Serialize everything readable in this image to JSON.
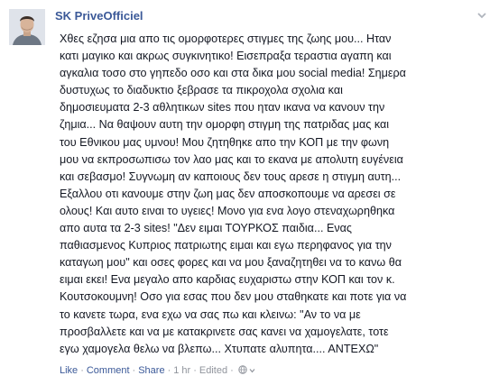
{
  "post": {
    "author": "SK PriveOfficiel",
    "text": "Χθες εζησα μια απο τις ομορφοτερες στιγμες της ζωης μου... Ηταν\nκατι μαγικο και ακρως συγκινητικο! Εισεπραξα τεραστια αγαπη και\nαγκαλια τοσο στο γηπεδο οσο και στα δικα μου social media! Σημερα\nδυστυχως το διαδυκτιο ξεβρασε τα πικροχολα σχολια και\nδημοσιευματα 2-3 αθλητικων sites που ηταν ικανα να κανουν την\nζημια... Να θαψουν αυτη την ομορφη στιγμη της πατριδας μας και\nτου Εθνικου μας υμνου! Μου ζητηθηκε απο την ΚΟΠ με την φωνη\nμου να εκπροσωπισω τον λαο μας και το εκανα με απολυτη ευγένεια\nκαι σεβασμο! Συγνωμη αν καποιους δεν τους αρεσε η στιγμη αυτη...\nΕξαλλου οτι κανουμε στην ζωη μας δεν αποσκοπουμε να αρεσει σε\nολους! Και αυτο ειναι το υγειες! Μονο για ενα λογο στεναχωρηθηκα\nαπο αυτα τα 2-3 sites! \"Δεν ειμαι ΤΟΥΡΚΟΣ παιδια... Ενας\nπαθιασμενος Κυπριος πατριωτης ειμαι και εγω περηφανος για την\nκαταγωη μου\" και οσες φορες και να μου ξαναζητηθει να το κανω θα\nειμαι εκει! Ενα μεγαλο απο καρδιας ευχαριστω στην ΚΟΠ και τον κ.\nΚουτσοκουμνη! Οσο για εσας που δεν μου σταθηκατε και ποτε για να\nτο κανετε τωρα, ενα εχω να σας πω και κλεινω: \"Αν το να με\nπροσβαλλετε και να με κατακρινετε σας κανει να χαμογελατε, τοτε\nεγω χαμογελα θελω να βλεπω... Χτυπατε αλυπητα.... ΑΝΤΕΧΩ\""
  },
  "footer": {
    "like": "Like",
    "comment": "Comment",
    "share": "Share",
    "time": "1 hr",
    "edited": "Edited",
    "separator": "·"
  },
  "icons": {
    "avatar": "profile-photo",
    "menu": "chevron-down-icon",
    "privacy": "globe-icon",
    "edited_dropdown": "chevron-down-icon"
  },
  "colors": {
    "link": "#3b5998",
    "text": "#141823",
    "meta": "#90949c"
  }
}
